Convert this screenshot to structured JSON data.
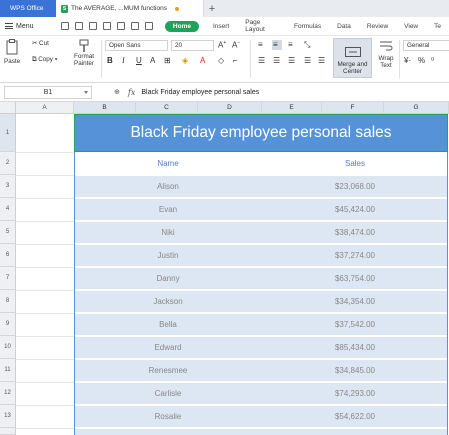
{
  "titlebar": {
    "app_tab": "WPS Office",
    "doc_icon": "S",
    "doc_tab": "The AVERAGE, ...MUM functions",
    "add_tab": "+"
  },
  "menubar": {
    "menu_label": "Menu",
    "tabs": [
      "Home",
      "Insert",
      "Page Layout",
      "Formulas",
      "Data",
      "Review",
      "View",
      "Te"
    ]
  },
  "ribbon": {
    "paste": "Paste",
    "cut": "Cut",
    "copy": "Copy",
    "format_painter": "Format Painter",
    "font_name": "Open Sans",
    "font_size": "20",
    "merge_center": "Merge and Center",
    "wrap_text": "Wrap Text",
    "number_format": "General"
  },
  "formula_bar": {
    "cell_ref": "B1",
    "fx": "fx",
    "content": "Black Friday employee personal sales"
  },
  "grid": {
    "columns": [
      "A",
      "B",
      "C",
      "D",
      "E",
      "F",
      "G"
    ],
    "rows": [
      "1",
      "2",
      "3",
      "4",
      "5",
      "6",
      "7",
      "8",
      "9",
      "10",
      "11",
      "12",
      "13"
    ]
  },
  "sheet": {
    "title": "Black Friday employee personal sales",
    "header": {
      "name": "Name",
      "sales": "Sales"
    },
    "records": [
      {
        "name": "Alison",
        "sales": "$23,068.00"
      },
      {
        "name": "Evan",
        "sales": "$45,424.00"
      },
      {
        "name": "Niki",
        "sales": "$38,474.00"
      },
      {
        "name": "Justin",
        "sales": "$37,274.00"
      },
      {
        "name": "Danny",
        "sales": "$63,754.00"
      },
      {
        "name": "Jackson",
        "sales": "$34,354.00"
      },
      {
        "name": "Bella",
        "sales": "$37,542.00"
      },
      {
        "name": "Edward",
        "sales": "$85,434.00"
      },
      {
        "name": "Renesmee",
        "sales": "$34,845.00"
      },
      {
        "name": "Carlisle",
        "sales": "$74,293.00"
      },
      {
        "name": "Rosalie",
        "sales": "$54,622.00"
      }
    ]
  },
  "colors": {
    "title_fill": "#5592d8",
    "band_fill": "#dde7f3",
    "home_tab": "#1fa35c",
    "app_tab": "#3a73d8",
    "selection_border": "#2f9e5a"
  }
}
